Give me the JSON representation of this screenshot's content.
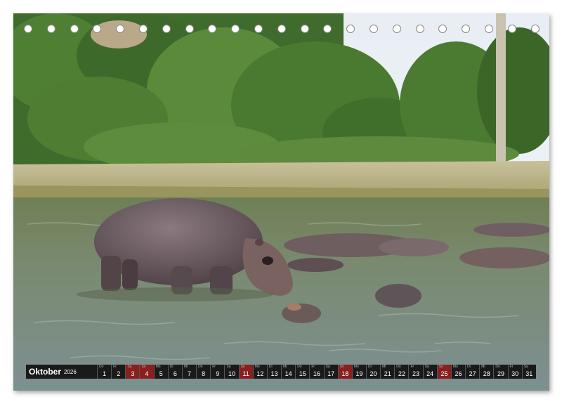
{
  "calendar": {
    "month": "Oktober",
    "year": "2026",
    "days": [
      {
        "wd": "Do",
        "n": "1",
        "sun": false
      },
      {
        "wd": "Fr",
        "n": "2",
        "sun": false
      },
      {
        "wd": "Sa",
        "n": "3",
        "sun": true
      },
      {
        "wd": "So",
        "n": "4",
        "sun": true
      },
      {
        "wd": "Mo",
        "n": "5",
        "sun": false
      },
      {
        "wd": "Di",
        "n": "6",
        "sun": false
      },
      {
        "wd": "Mi",
        "n": "7",
        "sun": false
      },
      {
        "wd": "Do",
        "n": "8",
        "sun": false
      },
      {
        "wd": "Fr",
        "n": "9",
        "sun": false
      },
      {
        "wd": "Sa",
        "n": "10",
        "sun": false
      },
      {
        "wd": "So",
        "n": "11",
        "sun": true
      },
      {
        "wd": "Mo",
        "n": "12",
        "sun": false
      },
      {
        "wd": "Di",
        "n": "13",
        "sun": false
      },
      {
        "wd": "Mi",
        "n": "14",
        "sun": false
      },
      {
        "wd": "Do",
        "n": "15",
        "sun": false
      },
      {
        "wd": "Fr",
        "n": "16",
        "sun": false
      },
      {
        "wd": "Sa",
        "n": "17",
        "sun": false
      },
      {
        "wd": "So",
        "n": "18",
        "sun": true
      },
      {
        "wd": "Mo",
        "n": "19",
        "sun": false
      },
      {
        "wd": "Di",
        "n": "20",
        "sun": false
      },
      {
        "wd": "Mi",
        "n": "21",
        "sun": false
      },
      {
        "wd": "Do",
        "n": "22",
        "sun": false
      },
      {
        "wd": "Fr",
        "n": "23",
        "sun": false
      },
      {
        "wd": "Sa",
        "n": "24",
        "sun": false
      },
      {
        "wd": "So",
        "n": "25",
        "sun": true
      },
      {
        "wd": "Mo",
        "n": "26",
        "sun": false
      },
      {
        "wd": "Di",
        "n": "27",
        "sun": false
      },
      {
        "wd": "Mi",
        "n": "28",
        "sun": false
      },
      {
        "wd": "Do",
        "n": "29",
        "sun": false
      },
      {
        "wd": "Fr",
        "n": "30",
        "sun": false
      },
      {
        "wd": "Sa",
        "n": "31",
        "sun": false
      }
    ]
  },
  "colors": {
    "sunday_cell": "#8a1f1f",
    "bar": "#1a1a1a"
  }
}
